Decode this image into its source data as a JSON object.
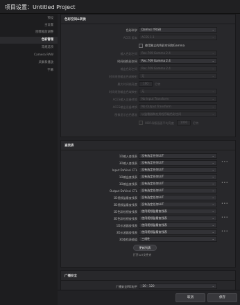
{
  "window": {
    "title": "项目设置：Untitled Project"
  },
  "sidebar": {
    "items": [
      {
        "label": "预设"
      },
      {
        "label": "主设置"
      },
      {
        "label": "图像缩放调整"
      },
      {
        "label": "色彩管理"
      },
      {
        "label": "常规选项"
      },
      {
        "label": "Camera RAW"
      },
      {
        "label": "采集和播放"
      },
      {
        "label": "字幕"
      }
    ],
    "active_index": 3
  },
  "color_space": {
    "header": "色彩空间&转换",
    "color_science_label": "色彩科学",
    "color_science_value": "DaVinci YRGB",
    "aces_version_label": "ACES 版本",
    "aces_version_value": "ACES 1.1",
    "separate_gamma_label": "使用独立的色彩空间和Gamma",
    "input_space_label": "输入色彩空间",
    "input_space_value": "Rec.709 Gamma 2.4",
    "timeline_space_label": "时间线色彩空间",
    "timeline_space_value": "Rec.709 Gamma 2.4",
    "output_space_label": "输出色彩空间",
    "output_space_value": "Rec.709 Gamma 2.4",
    "tone_mapping_label": "时间线到输出色调映射",
    "tone_mapping_value": "无",
    "max_brightness_label": "最大时间线亮度",
    "max_brightness_value": "100",
    "max_brightness_unit": "尼特",
    "gamut_mapping_label": "时间线到输出色域映射",
    "gamut_mapping_value": "无",
    "aces_input_label": "ACES输入设备转换",
    "aces_input_value": "No Input Transform",
    "aces_output_label": "ACES输出设备转换",
    "aces_output_value": "No Output Transform",
    "graphics_white_label": "图像显示白色基准",
    "graphics_white_value": "以监看器和应用程序级色彩空间",
    "hdr_mastering_label": "HDR母版画面平均亮度",
    "hdr_mastering_value": "1000",
    "hdr_mastering_unit": "尼特"
  },
  "lut": {
    "header": "查找表",
    "rows": [
      {
        "label": "1D输入查找表",
        "value": "没有选定任何LUT",
        "more": false
      },
      {
        "label": "3D输入查找表",
        "value": "没有选定任何LUT",
        "more": true
      },
      {
        "label": "Input DaVinci CTL",
        "value": "没有选定任何LUT",
        "more": false
      },
      {
        "label": "1D输出查找表",
        "value": "没有选定任何LUT",
        "more": false
      },
      {
        "label": "3D输出查找表",
        "value": "没有选定任何LUT",
        "more": true
      },
      {
        "label": "Output DaVinci CTL",
        "value": "没有选定任何LUT",
        "more": false
      },
      {
        "label": "1D视频监看查找表",
        "value": "没有选定任何LUT",
        "more": false
      },
      {
        "label": "3D视频监看查找表",
        "value": "没有选定任何LUT",
        "more": true
      },
      {
        "label": "1D色彩检视查找表",
        "value": "使用视频监看查找表",
        "more": false
      },
      {
        "label": "3D色彩检视查找表",
        "value": "使用视频监看查找表",
        "more": true
      },
      {
        "label": "1D示波器查找表",
        "value": "使用视频监看查找表",
        "more": false
      },
      {
        "label": "3D示波器查找表",
        "value": "使用视频监看查找表",
        "more": true
      },
      {
        "label": "3D查找表插值",
        "value": "三线性",
        "more": false
      }
    ],
    "update_button": "更新列表",
    "note": "打开LUT文件夹"
  },
  "broadcast": {
    "header": "广播安全",
    "irex_label": "广播安全IRE电平",
    "irex_value": "-20 - 120"
  },
  "footer": {
    "cancel_label": "取消",
    "save_label": "保存"
  },
  "icons": {
    "dropdown": "chevron-down-icon",
    "more": "more-icon",
    "checkbox": "checkbox-icon"
  }
}
